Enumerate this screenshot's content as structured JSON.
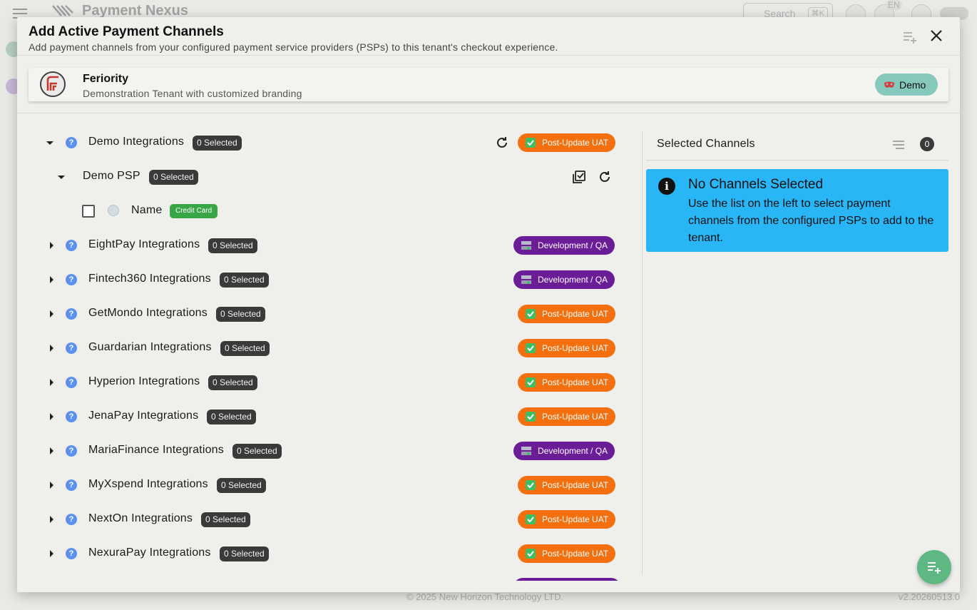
{
  "background": {
    "brand": "Payment Nexus",
    "search_placeholder": "Search",
    "search_shortcut": "⌘K",
    "lang": "EN",
    "footer_copyright": "© 2025 New Horizon Technology LTD.",
    "footer_version": "v2.20260513.0"
  },
  "modal": {
    "title": "Add Active Payment Channels",
    "subtitle": "Add payment channels from your configured payment service providers (PSPs) to this tenant's checkout experience."
  },
  "tenant": {
    "name": "Feriority",
    "description": "Demonstration Tenant with customized branding",
    "chip_label": "Demo"
  },
  "tree": {
    "expanded_group": {
      "label": "Demo Integrations",
      "count": "0 Selected",
      "env": "Post-Update UAT",
      "psp": {
        "label": "Demo PSP",
        "count": "0 Selected",
        "channel": {
          "name": "Name",
          "type": "Credit Card",
          "checked": false
        }
      }
    },
    "groups": [
      {
        "label": "EightPay Integrations",
        "count": "0 Selected",
        "env": "Development / QA",
        "kind": "dev"
      },
      {
        "label": "Fintech360 Integrations",
        "count": "0 Selected",
        "env": "Development / QA",
        "kind": "dev"
      },
      {
        "label": "GetMondo Integrations",
        "count": "0 Selected",
        "env": "Post-Update UAT",
        "kind": "uat"
      },
      {
        "label": "Guardarian Integrations",
        "count": "0 Selected",
        "env": "Post-Update UAT",
        "kind": "uat"
      },
      {
        "label": "Hyperion Integrations",
        "count": "0 Selected",
        "env": "Post-Update UAT",
        "kind": "uat"
      },
      {
        "label": "JenaPay Integrations",
        "count": "0 Selected",
        "env": "Post-Update UAT",
        "kind": "uat"
      },
      {
        "label": "MariaFinance Integrations",
        "count": "0 Selected",
        "env": "Development / QA",
        "kind": "dev"
      },
      {
        "label": "MyXspend Integrations",
        "count": "0 Selected",
        "env": "Post-Update UAT",
        "kind": "uat"
      },
      {
        "label": "NextOn Integrations",
        "count": "0 Selected",
        "env": "Post-Update UAT",
        "kind": "uat"
      },
      {
        "label": "NexuraPay Integrations",
        "count": "0 Selected",
        "env": "Post-Update UAT",
        "kind": "uat"
      }
    ]
  },
  "selected": {
    "title": "Selected Channels",
    "count": "0",
    "empty_title": "No Channels Selected",
    "empty_text": "Use the list on the left to select payment channels from the configured PSPs to add to the tenant."
  },
  "colors": {
    "uat": "#f4700f",
    "dev": "#6a1d97",
    "info": "#29b6f6",
    "fab": "#5fb884"
  }
}
